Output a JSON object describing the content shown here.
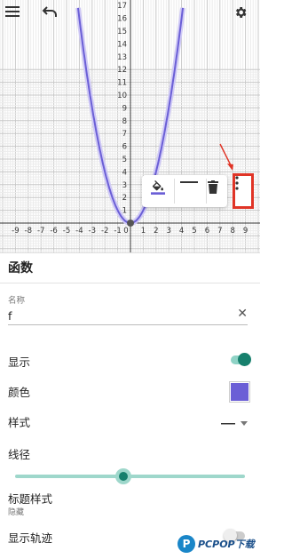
{
  "toolbar": {
    "menu_icon": "hamburger-menu-icon",
    "undo_icon": "undo-icon",
    "settings_icon": "gear-icon"
  },
  "graph": {
    "x_tick_labels": [
      "-9",
      "-8",
      "-7",
      "-6",
      "-5",
      "-4",
      "-3",
      "-2",
      "-1",
      "0",
      "1",
      "2",
      "3",
      "4",
      "5",
      "6",
      "7",
      "8",
      "9"
    ],
    "y_tick_labels": [
      "1",
      "2",
      "3",
      "4",
      "5",
      "6",
      "7",
      "8",
      "9",
      "10",
      "11",
      "12",
      "13",
      "14",
      "15",
      "16",
      "17"
    ],
    "function_color": "#6b5fd6"
  },
  "style_bar": {
    "fill_icon": "paint-bucket-icon",
    "line_icon": "line-style-icon",
    "delete_icon": "trash-icon",
    "more_icon": "more-vert-icon",
    "highlight_color": "#e03426"
  },
  "panel": {
    "title": "函数",
    "name_label": "名称",
    "name_value": "f",
    "clear_icon": "close-icon",
    "show_label": "显示",
    "show_on": true,
    "color_label": "颜色",
    "color_value": "#6b5fd6",
    "style_label": "样式",
    "thickness_label": "线径",
    "thickness_fraction": 0.47,
    "caption_style_label": "标题样式",
    "caption_style_value": "隐藏",
    "trace_label": "显示轨迹",
    "trace_on": false,
    "accent": "#17806d"
  },
  "watermark": {
    "text": "PCPOP下载"
  }
}
